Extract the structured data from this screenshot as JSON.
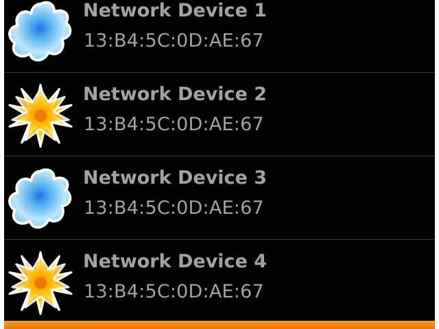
{
  "devices": [
    {
      "name": "Network Device 1",
      "mac": "13:B4:5C:0D:AE:67",
      "icon": "blue-splash-icon"
    },
    {
      "name": "Network Device 2",
      "mac": "13:B4:5C:0D:AE:67",
      "icon": "yellow-flower-icon"
    },
    {
      "name": "Network Device 3",
      "mac": "13:B4:5C:0D:AE:67",
      "icon": "blue-splash-icon"
    },
    {
      "name": "Network Device 4",
      "mac": "13:B4:5C:0D:AE:67",
      "icon": "yellow-flower-icon"
    }
  ],
  "colors": {
    "background": "#000000",
    "text": "#a3a3a3",
    "divider": "#3a3a3a",
    "focus_highlight": "#ff9a1f"
  }
}
